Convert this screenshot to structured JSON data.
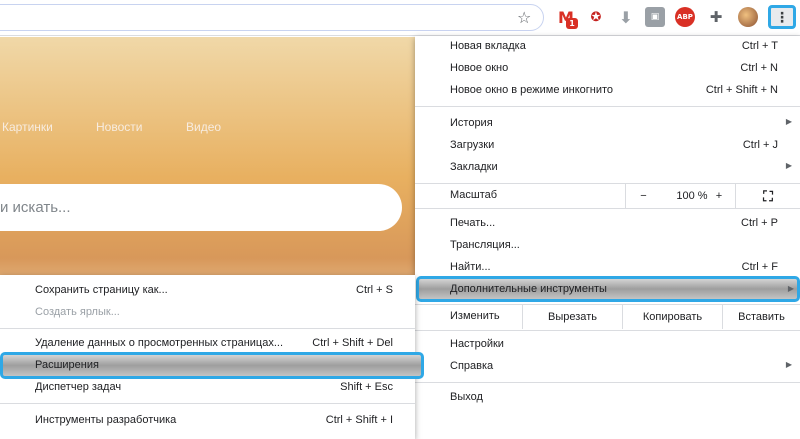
{
  "toolbar": {
    "gmail_badge": "1",
    "abp_label": "ABP",
    "menu_icon": "⋮",
    "icons": [
      "bookmark-star-icon",
      "gmail-icon",
      "extension-icon",
      "download-icon",
      "extension-icon",
      "adblock-plus-icon",
      "puzzle-icon",
      "avatar",
      "more-vert-icon"
    ]
  },
  "page": {
    "nav": [
      "Картинки",
      "Новости",
      "Видео"
    ],
    "search_placeholder": "и искать..."
  },
  "main_menu": {
    "new_tab": {
      "label": "Новая вкладка",
      "shortcut": "Ctrl + T"
    },
    "new_window": {
      "label": "Новое окно",
      "shortcut": "Ctrl + N"
    },
    "incognito": {
      "label": "Новое окно в режиме инкогнито",
      "shortcut": "Ctrl + Shift + N"
    },
    "history": {
      "label": "История"
    },
    "downloads": {
      "label": "Загрузки",
      "shortcut": "Ctrl + J"
    },
    "bookmarks": {
      "label": "Закладки"
    },
    "zoom": {
      "label": "Масштаб",
      "minus": "−",
      "value": "100 %",
      "plus": "+"
    },
    "print": {
      "label": "Печать...",
      "shortcut": "Ctrl + P"
    },
    "cast": {
      "label": "Трансляция..."
    },
    "find": {
      "label": "Найти...",
      "shortcut": "Ctrl + F"
    },
    "more_tools": {
      "label": "Дополнительные инструменты"
    },
    "edit": {
      "label": "Изменить",
      "cut": "Вырезать",
      "copy": "Копировать",
      "paste": "Вставить"
    },
    "settings": {
      "label": "Настройки"
    },
    "help": {
      "label": "Справка"
    },
    "exit": {
      "label": "Выход"
    }
  },
  "sub_menu": {
    "save_page": {
      "label": "Сохранить страницу как...",
      "shortcut": "Ctrl + S"
    },
    "create_shortcut": {
      "label": "Создать ярлык..."
    },
    "clear_data": {
      "label": "Удаление данных о просмотренных страницах...",
      "shortcut": "Ctrl + Shift + Del"
    },
    "extensions": {
      "label": "Расширения"
    },
    "task_manager": {
      "label": "Диспетчер задач",
      "shortcut": "Shift + Esc"
    },
    "dev_tools": {
      "label": "Инструменты разработчика",
      "shortcut": "Ctrl + Shift + I"
    }
  },
  "colors": {
    "highlight_border": "#2fa8e6",
    "menu_bg": "#ffffff"
  }
}
